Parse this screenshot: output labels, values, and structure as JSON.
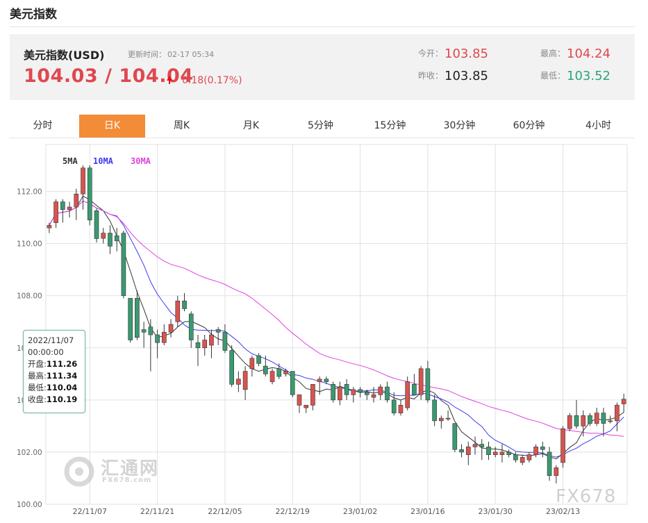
{
  "page": {
    "title": "美元指数"
  },
  "quote": {
    "name": "美元指数(USD)",
    "update_label": "更新时间：",
    "update_time": "02-17 05:34",
    "price": "104.03 / 104.04",
    "change": "0.18(0.17%)",
    "open_label": "今开：",
    "open": "103.85",
    "prev_close_label": "昨收：",
    "prev_close": "103.85",
    "high_label": "最高：",
    "high": "104.24",
    "low_label": "最低：",
    "low": "103.52",
    "colors": {
      "up": "#e0474f",
      "down": "#2aa57a"
    }
  },
  "tabs": [
    {
      "label": "分时"
    },
    {
      "label": "日K",
      "active": true
    },
    {
      "label": "周K"
    },
    {
      "label": "月K"
    },
    {
      "label": "5分钟"
    },
    {
      "label": "15分钟"
    },
    {
      "label": "30分钟"
    },
    {
      "label": "60分钟"
    },
    {
      "label": "4小时"
    }
  ],
  "tooltip": {
    "date": "2022/11/07",
    "time": "00:00:00",
    "open_label": "开盘:",
    "open": "111.26",
    "high_label": "最高:",
    "high": "111.34",
    "low_label": "最低:",
    "low": "110.04",
    "close_label": "收盘:",
    "close": "110.19"
  },
  "watermarks": {
    "site_cn": "汇通网",
    "site_url": "FX678.com",
    "brand": "FX678"
  },
  "chart_data": {
    "type": "candlestick",
    "ylim": [
      100,
      113.8
    ],
    "y_ticks": [
      "100.00",
      "102.00",
      "104.00",
      "106.00",
      "108.00",
      "110.00",
      "112.00"
    ],
    "x_ticks": [
      "22/11/07",
      "22/11/21",
      "22/12/05",
      "22/12/19",
      "23/01/02",
      "23/01/16",
      "23/01/30",
      "23/02/13"
    ],
    "x_tick_index": [
      6,
      16,
      26,
      36,
      46,
      56,
      66,
      76
    ],
    "legend": [
      {
        "name": "5MA",
        "color": "#333333"
      },
      {
        "name": "10MA",
        "color": "#3a3af0"
      },
      {
        "name": "30MA",
        "color": "#e040e0"
      }
    ],
    "colors": {
      "up": "#d9534f",
      "down": "#3a9970",
      "grid": "#e1e1e6"
    },
    "ohlc": [
      [
        110.6,
        110.8,
        110.4,
        110.7
      ],
      [
        110.8,
        111.7,
        110.6,
        111.6
      ],
      [
        111.6,
        111.7,
        110.8,
        111.3
      ],
      [
        111.3,
        111.6,
        111.0,
        111.4
      ],
      [
        111.4,
        112.1,
        110.9,
        111.9
      ],
      [
        111.9,
        113.0,
        111.3,
        112.9
      ],
      [
        112.9,
        113.0,
        110.7,
        110.9
      ],
      [
        111.26,
        111.34,
        110.04,
        110.19
      ],
      [
        110.2,
        110.6,
        110.0,
        110.4
      ],
      [
        110.4,
        110.7,
        109.6,
        109.9
      ],
      [
        110.3,
        110.6,
        109.7,
        110.1
      ],
      [
        110.4,
        110.5,
        107.9,
        108.0
      ],
      [
        107.9,
        107.9,
        106.2,
        106.3
      ],
      [
        107.9,
        108.2,
        106.3,
        106.4
      ],
      [
        106.7,
        107.0,
        106.0,
        106.6
      ],
      [
        106.8,
        107.1,
        105.1,
        106.5
      ],
      [
        106.5,
        106.7,
        105.6,
        106.2
      ],
      [
        106.2,
        106.9,
        106.1,
        106.6
      ],
      [
        106.6,
        107.1,
        106.4,
        106.9
      ],
      [
        107.0,
        108.0,
        106.8,
        107.8
      ],
      [
        107.8,
        108.1,
        107.4,
        107.5
      ],
      [
        107.3,
        107.4,
        106.0,
        106.3
      ],
      [
        106.2,
        106.5,
        105.3,
        106.0
      ],
      [
        106.0,
        106.5,
        105.7,
        106.3
      ],
      [
        106.1,
        106.7,
        105.6,
        106.5
      ],
      [
        106.7,
        106.8,
        106.1,
        106.6
      ],
      [
        106.6,
        106.9,
        105.8,
        105.9
      ],
      [
        105.9,
        106.1,
        104.5,
        104.6
      ],
      [
        104.6,
        105.1,
        104.3,
        104.8
      ],
      [
        104.4,
        105.3,
        104.0,
        105.1
      ],
      [
        105.2,
        105.7,
        104.9,
        105.6
      ],
      [
        105.7,
        105.8,
        105.3,
        105.4
      ],
      [
        105.3,
        105.7,
        104.9,
        105.0
      ],
      [
        104.7,
        105.2,
        104.6,
        105.1
      ],
      [
        105.2,
        105.4,
        104.8,
        104.9
      ],
      [
        105.0,
        105.2,
        104.9,
        105.1
      ],
      [
        105.1,
        105.1,
        104.1,
        104.2
      ],
      [
        103.8,
        104.1,
        103.5,
        104.2
      ],
      [
        103.7,
        103.8,
        103.5,
        103.8
      ],
      [
        103.8,
        104.6,
        103.6,
        104.6
      ],
      [
        104.7,
        104.9,
        104.2,
        104.8
      ],
      [
        104.8,
        104.9,
        104.6,
        104.7
      ],
      [
        104.6,
        104.7,
        103.9,
        104.0
      ],
      [
        104.0,
        104.7,
        103.8,
        104.5
      ],
      [
        104.6,
        104.8,
        104.0,
        104.2
      ],
      [
        104.2,
        104.5,
        103.9,
        104.4
      ],
      [
        104.4,
        104.5,
        104.1,
        104.3
      ],
      [
        104.3,
        104.4,
        104.0,
        104.2
      ],
      [
        104.1,
        104.5,
        103.9,
        104.2
      ],
      [
        104.2,
        104.6,
        104.0,
        104.5
      ],
      [
        104.5,
        104.7,
        103.9,
        104.0
      ],
      [
        104.0,
        104.3,
        103.4,
        103.5
      ],
      [
        103.5,
        104.0,
        103.4,
        103.8
      ],
      [
        103.7,
        104.9,
        103.6,
        104.7
      ],
      [
        104.6,
        105.0,
        104.2,
        104.2
      ],
      [
        104.2,
        105.3,
        104.0,
        105.2
      ],
      [
        105.2,
        105.5,
        103.9,
        104.0
      ],
      [
        104.0,
        104.2,
        103.0,
        103.2
      ],
      [
        103.2,
        103.4,
        102.9,
        103.3
      ],
      [
        103.3,
        103.6,
        103.2,
        103.3
      ],
      [
        103.1,
        103.1,
        102.0,
        102.1
      ],
      [
        102.1,
        102.3,
        101.8,
        102.0
      ],
      [
        101.9,
        102.4,
        101.5,
        102.2
      ],
      [
        102.2,
        102.6,
        101.9,
        102.3
      ],
      [
        102.3,
        102.5,
        101.7,
        102.2
      ],
      [
        102.2,
        102.4,
        101.7,
        101.9
      ],
      [
        101.9,
        102.2,
        101.8,
        102.0
      ],
      [
        101.9,
        102.3,
        101.6,
        102.0
      ],
      [
        102.0,
        102.1,
        101.8,
        101.9
      ],
      [
        101.9,
        102.0,
        101.6,
        101.7
      ],
      [
        101.6,
        101.9,
        101.5,
        101.8
      ],
      [
        101.7,
        102.0,
        101.6,
        101.9
      ],
      [
        101.9,
        102.3,
        101.8,
        102.2
      ],
      [
        102.2,
        102.4,
        101.8,
        102.1
      ],
      [
        102.0,
        102.2,
        100.9,
        101.1
      ],
      [
        101.1,
        101.5,
        100.8,
        101.4
      ],
      [
        101.6,
        103.0,
        101.4,
        102.9
      ],
      [
        102.9,
        103.5,
        102.8,
        103.4
      ],
      [
        103.4,
        104.0,
        102.9,
        103.0
      ],
      [
        103.0,
        103.6,
        102.6,
        103.4
      ],
      [
        103.4,
        103.5,
        103.0,
        103.1
      ],
      [
        103.1,
        103.7,
        103.0,
        103.5
      ],
      [
        103.5,
        103.7,
        102.6,
        103.1
      ],
      [
        103.2,
        103.4,
        103.1,
        103.2
      ],
      [
        103.2,
        103.9,
        102.8,
        103.8
      ],
      [
        103.85,
        104.24,
        103.52,
        104.03
      ]
    ]
  }
}
